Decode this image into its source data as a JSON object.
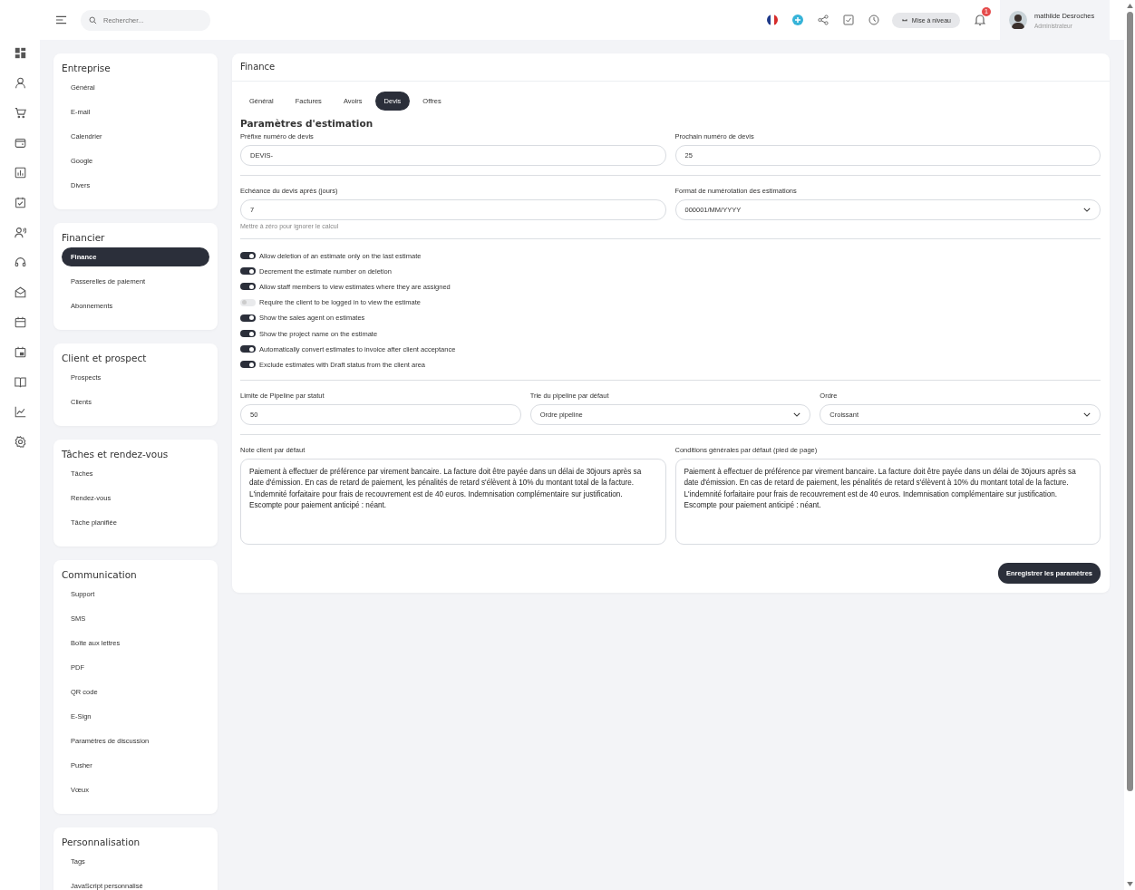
{
  "search": {
    "placeholder": "Rechercher..."
  },
  "header": {
    "upgrade_button": "Mise à niveau",
    "notification_count": "1",
    "user": {
      "name": "mathilde Desroches",
      "role": "Administrateur"
    }
  },
  "settings_menu": [
    {
      "title": "Entreprise",
      "items": [
        {
          "label": "Général",
          "selected": false
        },
        {
          "label": "E-mail",
          "selected": false
        },
        {
          "label": "Calendrier",
          "selected": false
        },
        {
          "label": "Google",
          "selected": false
        },
        {
          "label": "Divers",
          "selected": false
        }
      ]
    },
    {
      "title": "Financier",
      "items": [
        {
          "label": "Finance",
          "selected": true
        },
        {
          "label": "Passerelles de paiement",
          "selected": false
        },
        {
          "label": "Abonnements",
          "selected": false
        }
      ]
    },
    {
      "title": "Client et prospect",
      "items": [
        {
          "label": "Prospects",
          "selected": false
        },
        {
          "label": "Clients",
          "selected": false
        }
      ]
    },
    {
      "title": "Tâches et rendez-vous",
      "items": [
        {
          "label": "Tâches",
          "selected": false
        },
        {
          "label": "Rendez-vous",
          "selected": false
        },
        {
          "label": "Tâche planifiée",
          "selected": false
        }
      ]
    },
    {
      "title": "Communication",
      "items": [
        {
          "label": "Support",
          "selected": false
        },
        {
          "label": "SMS",
          "selected": false
        },
        {
          "label": "Boîte aux lettres",
          "selected": false
        },
        {
          "label": "PDF",
          "selected": false
        },
        {
          "label": "QR code",
          "selected": false
        },
        {
          "label": "E-Sign",
          "selected": false
        },
        {
          "label": "Paramètres de discussion",
          "selected": false
        },
        {
          "label": "Pusher",
          "selected": false
        },
        {
          "label": "Vœux",
          "selected": false
        }
      ]
    },
    {
      "title": "Personnalisation",
      "items": [
        {
          "label": "Tags",
          "selected": false
        },
        {
          "label": "JavaScript personnalisé",
          "selected": false
        }
      ]
    }
  ],
  "panel": {
    "title": "Finance",
    "tabs": [
      {
        "label": "Général",
        "selected": false
      },
      {
        "label": "Factures",
        "selected": false
      },
      {
        "label": "Avoirs",
        "selected": false
      },
      {
        "label": "Devis",
        "selected": true
      },
      {
        "label": "Offres",
        "selected": false
      }
    ],
    "section_title": "Paramètres d'estimation",
    "number_rows": [
      [
        {
          "kind": "input",
          "label": "Préfixe numéro de devis",
          "value": "DEVIS-"
        },
        {
          "kind": "input",
          "label": "Prochain numéro de devis",
          "value": "25"
        }
      ],
      [
        {
          "kind": "input",
          "label": "Echéance du devis après (jours)",
          "value": "7",
          "hint": "Mettre à zéro pour ignorer le calcul"
        },
        {
          "kind": "select",
          "label": "Format de numérotation des estimations",
          "value": "000001/MM/YYYY"
        }
      ]
    ],
    "toggles": [
      {
        "label": "Allow deletion of an estimate only on the last estimate",
        "on": true
      },
      {
        "label": "Decrement the estimate number on deletion",
        "on": true
      },
      {
        "label": "Allow staff members to view estimates where they are assigned",
        "on": true
      },
      {
        "label": "Require the client to be logged in to view the estimate",
        "on": false
      },
      {
        "label": "Show the sales agent on estimates",
        "on": true
      },
      {
        "label": "Show the project name on the estimate",
        "on": true
      },
      {
        "label": "Automatically convert estimates to invoice after client acceptance",
        "on": true
      },
      {
        "label": "Exclude estimates with Draft status from the client area",
        "on": true
      }
    ],
    "pipeline_fields": [
      {
        "kind": "input",
        "label": "Limite de Pipeline par statut",
        "value": "50"
      },
      {
        "kind": "select",
        "label": "Trie du pipeline par défaut",
        "value": "Ordre pipeline"
      },
      {
        "kind": "select",
        "label": "Ordre",
        "value": "Croissant"
      }
    ],
    "notes": [
      {
        "kind": "textarea",
        "label": "Note client par défaut",
        "value": "Paiement à effectuer de préférence par virement bancaire. La facture doit être payée dans un délai de 30jours après sa date d'émission. En cas de retard de paiement, les pénalités de retard s'élèvent à 10% du montant total de la facture. L'indemnité forfaitaire pour frais de recouvrement est de 40 euros. Indemnisation complémentaire sur justification. Escompte pour paiement anticipé : néant."
      },
      {
        "kind": "textarea",
        "label": "Conditions générales par défaut (pied de page)",
        "value": "Paiement à effectuer de préférence par virement bancaire. La facture doit être payée dans un délai de 30jours après sa date d'émission. En cas de retard de paiement, les pénalités de retard s'élèvent à 10% du montant total de la facture. L'indemnité forfaitaire pour frais de recouvrement est de 40 euros. Indemnisation complémentaire sur justification. Escompte pour paiement anticipé : néant."
      }
    ],
    "save_button": "Enregistrer les paramètres"
  }
}
